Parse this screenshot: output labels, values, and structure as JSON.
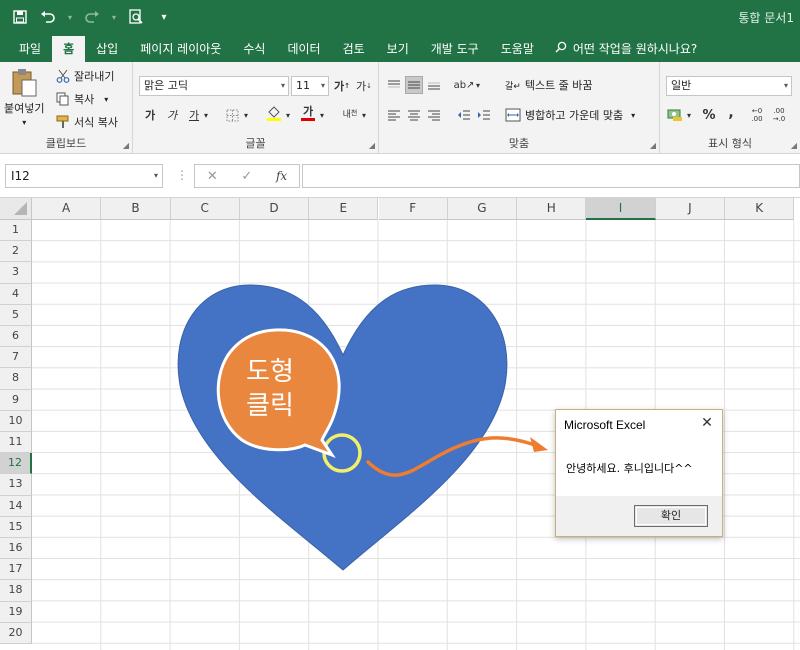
{
  "title_bar": {
    "doc_title": "통합 문서1"
  },
  "qat": {
    "customize_glyph": "▾"
  },
  "tabs": [
    {
      "label": "파일"
    },
    {
      "label": "홈"
    },
    {
      "label": "삽입"
    },
    {
      "label": "페이지 레이아웃"
    },
    {
      "label": "수식"
    },
    {
      "label": "데이터"
    },
    {
      "label": "검토"
    },
    {
      "label": "보기"
    },
    {
      "label": "개발 도구"
    },
    {
      "label": "도움말"
    }
  ],
  "tell_me": "어떤 작업을 원하시나요?",
  "ribbon": {
    "clipboard": {
      "paste": "붙여넣기",
      "cut": "잘라내기",
      "copy": "복사",
      "format_painter": "서식 복사",
      "label": "클립보드"
    },
    "font": {
      "name": "맑은 고딕",
      "size": "11",
      "label": "글꼴",
      "bold": "가",
      "italic": "가",
      "underline": "가"
    },
    "alignment": {
      "wrap_text": "텍스트 줄 바꿈",
      "merge_center": "병합하고 가운데 맞춤",
      "label": "맞춤"
    },
    "number": {
      "format": "일반",
      "label": "표시 형식",
      "percent": "%",
      "comma": ","
    }
  },
  "formula_bar": {
    "name_box": "I12",
    "cancel": "✕",
    "enter": "✓",
    "fx": "fx",
    "formula": ""
  },
  "columns": [
    "A",
    "B",
    "C",
    "D",
    "E",
    "F",
    "G",
    "H",
    "I",
    "J",
    "K"
  ],
  "selected_column": "I",
  "rows": [
    "1",
    "2",
    "3",
    "4",
    "5",
    "6",
    "7",
    "8",
    "9",
    "10",
    "11",
    "12",
    "13",
    "14",
    "15",
    "16",
    "17",
    "18",
    "19",
    "20"
  ],
  "selected_row": "12",
  "shape": {
    "bubble_text_line1": "도형",
    "bubble_text_line2": "클릭"
  },
  "colors": {
    "excel_green": "#217346",
    "heart": "#4472c4",
    "bubble": "#e8873d",
    "arrow": "#ed7d31",
    "ring": "#f2ef6b"
  },
  "dialog": {
    "title": "Microsoft Excel",
    "message": "안녕하세요. 후니입니다^^",
    "ok": "확인",
    "close": "✕"
  }
}
